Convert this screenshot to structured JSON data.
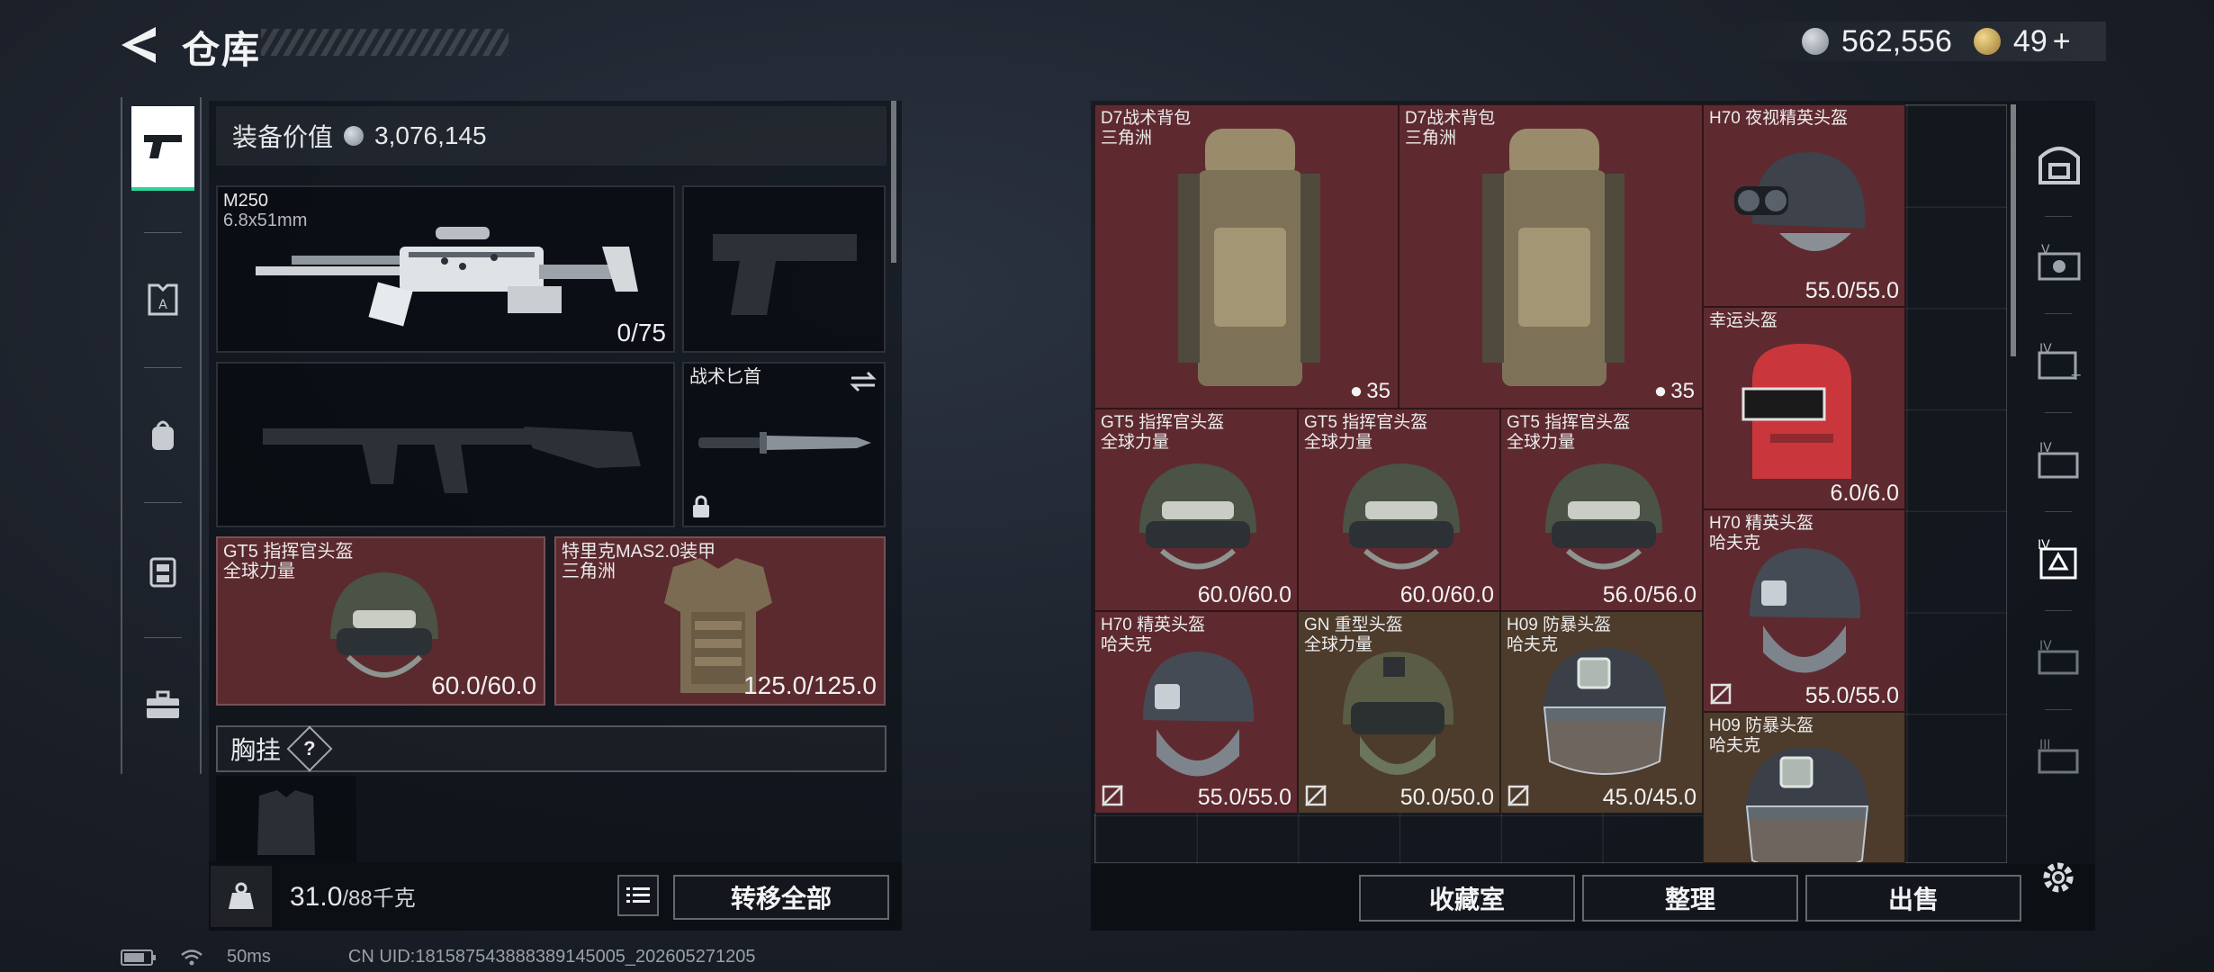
{
  "header": {
    "title": "仓库",
    "silver_amount": "562,556",
    "gold_amount": "49",
    "gold_plus": "+"
  },
  "left_nav": {
    "items": [
      {
        "name": "weapon",
        "icon": "pistol-icon",
        "active": true
      },
      {
        "name": "armor",
        "icon": "armor-plate-icon",
        "active": false
      },
      {
        "name": "backpack",
        "icon": "backpack-icon",
        "active": false
      },
      {
        "name": "vest",
        "icon": "vest-icon",
        "active": false
      },
      {
        "name": "toolbox",
        "icon": "toolbox-icon",
        "active": false
      }
    ]
  },
  "loadout": {
    "value_label": "装备价值",
    "value_amount": "3,076,145",
    "primary": {
      "name": "M250",
      "caliber": "6.8x51mm",
      "ammo": "0/75"
    },
    "melee": {
      "name": "战术匕首"
    },
    "helmet": {
      "name": "GT5 指挥官头盔",
      "maker": "全球力量",
      "durability": "60.0/60.0"
    },
    "armor": {
      "name": "特里克MAS2.0装甲",
      "maker": "三角洲",
      "durability": "125.0/125.0"
    },
    "vest_label": "胸挂",
    "vest_hint": "?",
    "weight_current": "31.0",
    "weight_max": "/88千克",
    "transfer_all": "转移全部"
  },
  "stash": {
    "items": [
      {
        "name": "D7战术背包",
        "maker": "三角洲",
        "capacity": "35",
        "color": "red"
      },
      {
        "name": "D7战术背包",
        "maker": "三角洲",
        "capacity": "35",
        "color": "red"
      },
      {
        "name": "H70 夜视精英头盔",
        "maker": "",
        "durability": "55.0/55.0",
        "color": "red"
      },
      {
        "name": "幸运头盔",
        "maker": "",
        "durability": "6.0/6.0",
        "color": "red"
      },
      {
        "name": "GT5 指挥官头盔",
        "maker": "全球力量",
        "durability": "60.0/60.0",
        "color": "red"
      },
      {
        "name": "GT5 指挥官头盔",
        "maker": "全球力量",
        "durability": "60.0/60.0",
        "color": "red"
      },
      {
        "name": "GT5 指挥官头盔",
        "maker": "全球力量",
        "durability": "56.0/56.0",
        "color": "red"
      },
      {
        "name": "H70 精英头盔",
        "maker": "哈夫克",
        "durability": "55.0/55.0",
        "color": "red"
      },
      {
        "name": "H70 精英头盔",
        "maker": "哈夫克",
        "durability": "55.0/55.0",
        "color": "red"
      },
      {
        "name": "GN 重型头盔",
        "maker": "全球力量",
        "durability": "50.0/50.0",
        "color": "brown"
      },
      {
        "name": "H09 防暴头盔",
        "maker": "哈夫克",
        "durability": "45.0/45.0",
        "color": "brown"
      },
      {
        "name": "H09 防暴头盔",
        "maker": "哈夫克",
        "durability": "",
        "color": "brown"
      }
    ],
    "buttons": {
      "collection": "收藏室",
      "sort": "整理",
      "sell": "出售"
    }
  },
  "right_nav": {
    "items": [
      "vault-icon",
      "case-v-icon",
      "case-iv-add-icon",
      "case-iv-folder-icon",
      "case-iv-active-icon",
      "case-iv-icon",
      "case-iii-icon"
    ]
  },
  "footer": {
    "ping": "50ms",
    "uid": "CN UID:1815875438883891450​05_202605271205"
  }
}
